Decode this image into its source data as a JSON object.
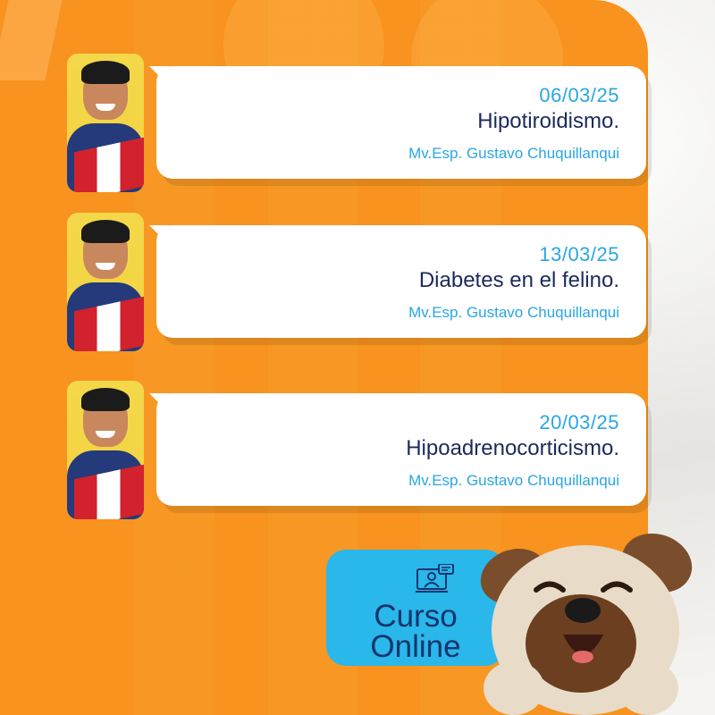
{
  "sessions": [
    {
      "date": "06/03/25",
      "topic": "Hipotiroidismo.",
      "speaker": "Mv.Esp. Gustavo Chuquillanqui"
    },
    {
      "date": "13/03/25",
      "topic": "Diabetes en el felino.",
      "speaker": "Mv.Esp. Gustavo Chuquillanqui"
    },
    {
      "date": "20/03/25",
      "topic": "Hipoadrenocorticismo.",
      "speaker": "Mv.Esp. Gustavo Chuquillanqui"
    }
  ],
  "badge": {
    "line1": "Curso",
    "line2": "Online",
    "icon": "online-class-icon"
  },
  "colors": {
    "orange": "#f7931e",
    "accent_blue": "#29a6e2",
    "navy": "#1c2a59",
    "badge_blue": "#2ab7ea"
  }
}
